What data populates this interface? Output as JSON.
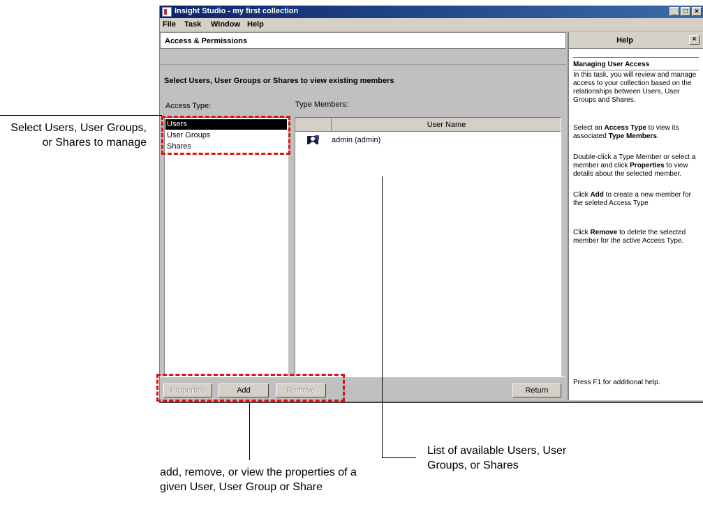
{
  "window": {
    "title": "Insight Studio - my first collection",
    "controls": [
      "_",
      "□",
      "×"
    ]
  },
  "menu": [
    {
      "label": "File"
    },
    {
      "label": "Task"
    },
    {
      "label": "Window"
    },
    {
      "label": "Help"
    }
  ],
  "panel": {
    "header": "Access & Permissions",
    "instruction": "Select Users, User Groups or Shares to view existing members",
    "access_type_label": "Access Type:",
    "type_members_label": "Type Members:"
  },
  "access_types": [
    {
      "label": "Users",
      "selected": true
    },
    {
      "label": "User Groups",
      "selected": false
    },
    {
      "label": "Shares",
      "selected": false
    }
  ],
  "members": {
    "column_header": "User Name",
    "rows": [
      {
        "icon": "user-icon",
        "name": "admin (admin)"
      }
    ]
  },
  "toolbar": {
    "properties": "Properties",
    "add": "Add",
    "remove": "Remove",
    "return": "Return"
  },
  "help": {
    "title": "Help",
    "close": "×",
    "heading": "Managing User Access",
    "p1": "In this task, you will review and manage access to your collection based on the relationships between Users, User Groups and Shares.",
    "p2_pre": "Select an ",
    "p2_b1": "Access Type",
    "p2_mid": " to view its associated ",
    "p2_b2": "Type Members",
    "p2_post": ".",
    "p3_pre": "Double-click a Type Member or select a member and click ",
    "p3_b1": "Properties",
    "p3_post": " to view details about the selected member.",
    "p4_pre": "Click ",
    "p4_b1": "Add",
    "p4_post": " to create a new member for the seleted Access Type",
    "p5_pre": "Click ",
    "p5_b1": "Remove",
    "p5_post": " to delete the selected member for the active Access Type.",
    "footer": "Press F1 for additional help."
  },
  "annotations": {
    "left": "Select Users, User Groups, or Shares to manage",
    "bottom_left": "add, remove, or view the properties of a given User, User Group or Share",
    "bottom_right": "List of available Users, User Groups, or Shares"
  },
  "colors": {
    "annotation_box": "#e01010",
    "titlebar_start": "#0a246a",
    "titlebar_end": "#3a6ea5",
    "window_bg": "#c0c0c0"
  }
}
